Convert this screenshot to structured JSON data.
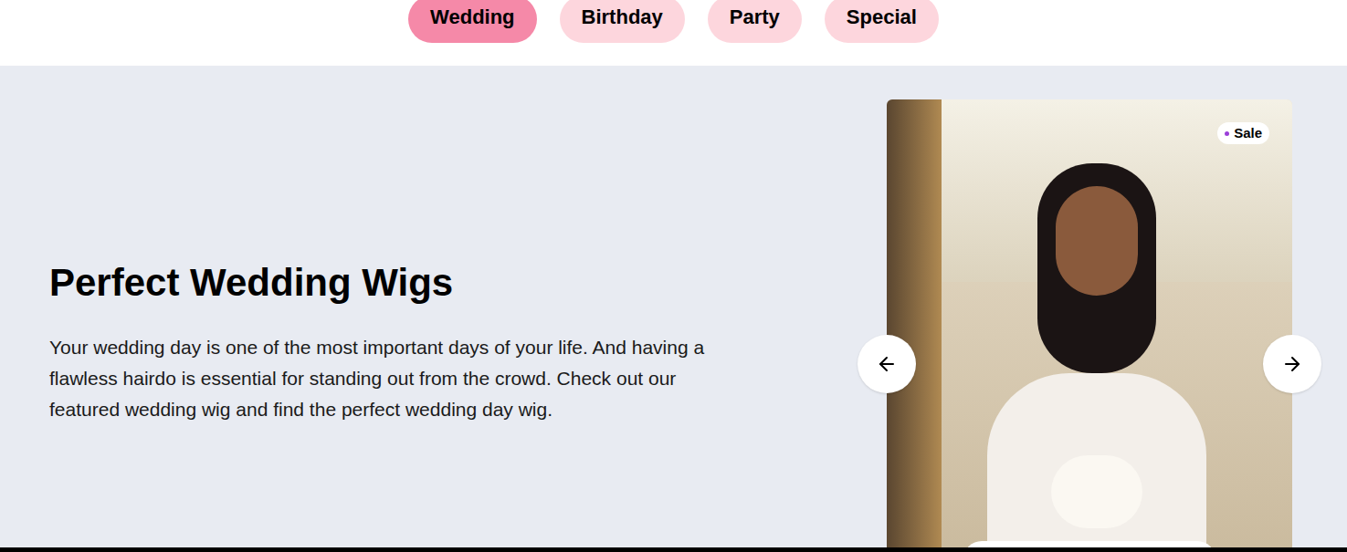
{
  "tabs": [
    {
      "label": "Wedding",
      "selected": true
    },
    {
      "label": "Birthday",
      "selected": false
    },
    {
      "label": "Party",
      "selected": false
    },
    {
      "label": "Special",
      "selected": false
    }
  ],
  "hero": {
    "title": "Perfect Wedding Wigs",
    "description": "Your wedding day is one of the most important days of your life. And having a flawless hairdo is essential for standing out from the crowd. Check out our featured wedding wig and find the perfect wedding day wig."
  },
  "product": {
    "badge": "Sale"
  }
}
